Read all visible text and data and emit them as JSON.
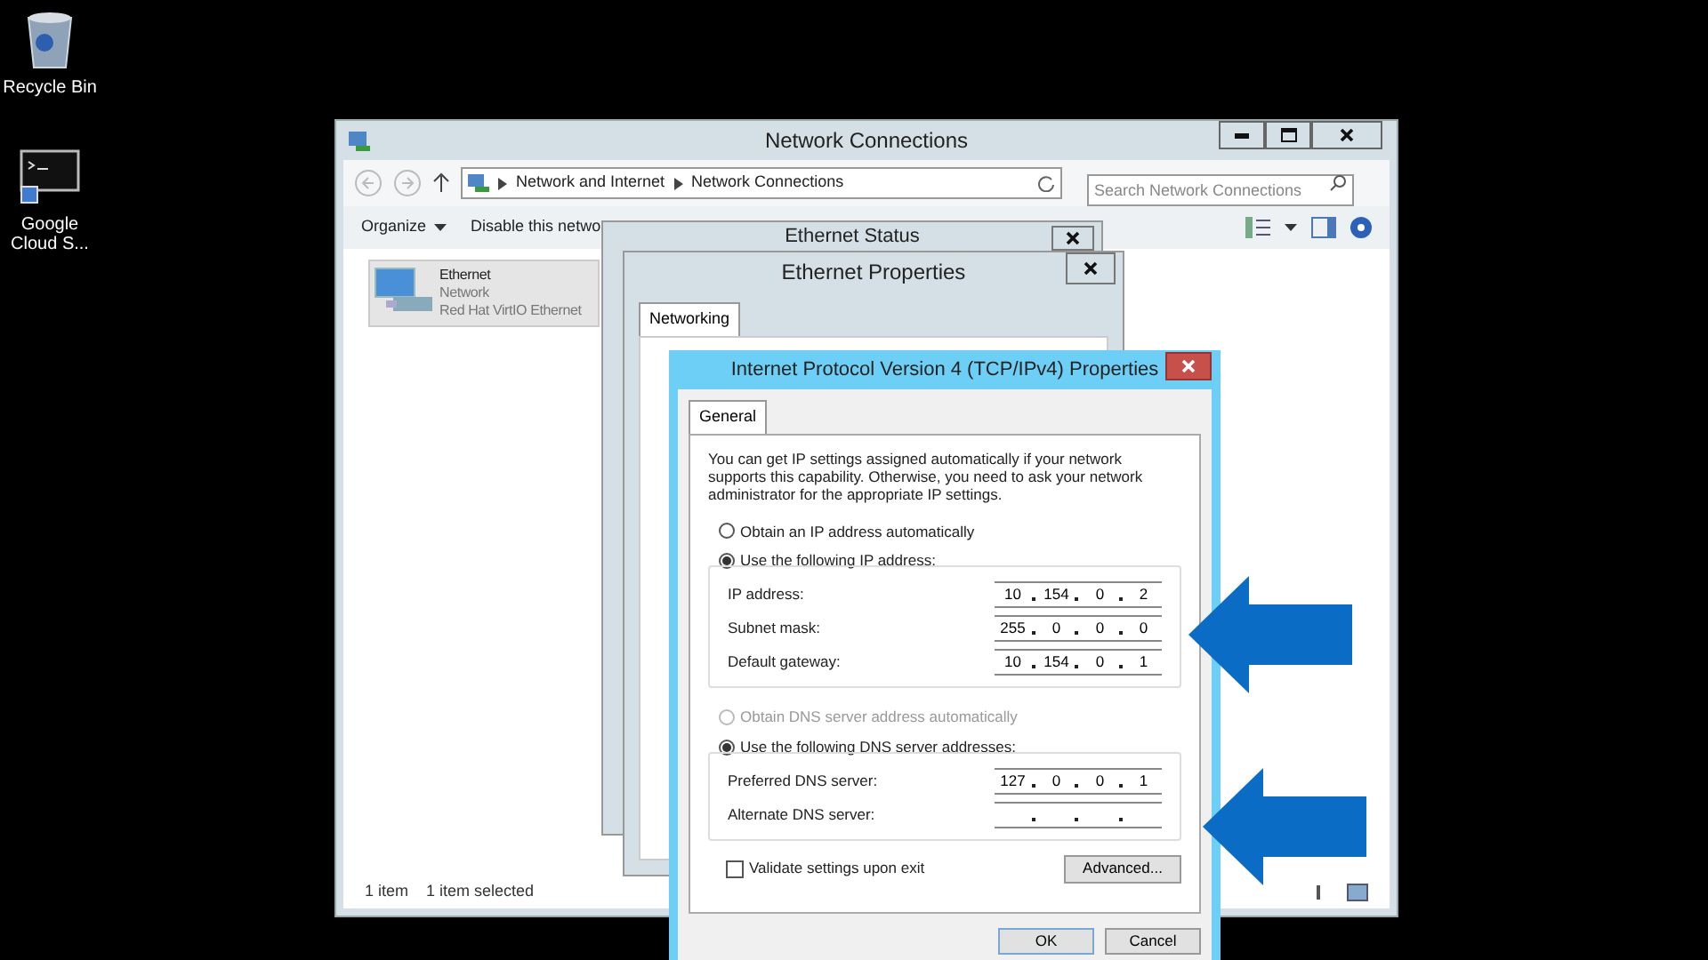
{
  "desktop_icons": [
    {
      "kind": "bin",
      "label": "Recycle Bin"
    },
    {
      "kind": "console",
      "label": "Google Cloud S..."
    }
  ],
  "explorer": {
    "title": "Network Connections",
    "breadcrumb": [
      "Network and Internet",
      "Network Connections"
    ],
    "search": {
      "placeholder": "Search Network Connections"
    },
    "toolbar": [
      {
        "label": "Organize",
        "menu": true
      },
      {
        "label": "Disable this netwo",
        "menu": false
      }
    ],
    "items": [
      {
        "name": "Ethernet",
        "status": "Network",
        "device": "Red Hat VirtIO Ethernet",
        "selected": true
      }
    ],
    "status_bar": [
      "1 item",
      "1 item selected"
    ]
  },
  "status_window": {
    "title": "Ethernet Status"
  },
  "properties_window": {
    "title": "Ethernet Properties",
    "tabs": [
      {
        "label": "Networking",
        "selected": true
      }
    ]
  },
  "ipv4_dialog": {
    "title": "Internet Protocol Version 4 (TCP/IPv4) Properties",
    "tabs": [
      {
        "label": "General",
        "selected": true
      }
    ],
    "intro": "You can get IP settings assigned automatically if your network supports this capability. Otherwise, you need to ask your network administrator for the appropriate IP settings.",
    "ip_options": [
      {
        "label": "Obtain an IP address automatically",
        "selected": false,
        "disabled": false
      },
      {
        "label": "Use the following IP address:",
        "selected": true,
        "disabled": false
      }
    ],
    "ip_fields": [
      {
        "label": "IP address:",
        "octets": [
          "10",
          "154",
          "0",
          "2"
        ]
      },
      {
        "label": "Subnet mask:",
        "octets": [
          "255",
          "0",
          "0",
          "0"
        ]
      },
      {
        "label": "Default gateway:",
        "octets": [
          "10",
          "154",
          "0",
          "1"
        ]
      }
    ],
    "dns_options": [
      {
        "label": "Obtain DNS server address automatically",
        "selected": false,
        "disabled": true
      },
      {
        "label": "Use the following DNS server addresses:",
        "selected": true,
        "disabled": false
      }
    ],
    "dns_fields": [
      {
        "label": "Preferred DNS server:",
        "octets": [
          "127",
          "0",
          "0",
          "1"
        ]
      },
      {
        "label": "Alternate DNS server:"
      }
    ],
    "validate": {
      "label": "Validate settings upon exit",
      "checked": false
    },
    "advanced_button": "Advanced...",
    "buttons": [
      "OK",
      "Cancel"
    ]
  }
}
